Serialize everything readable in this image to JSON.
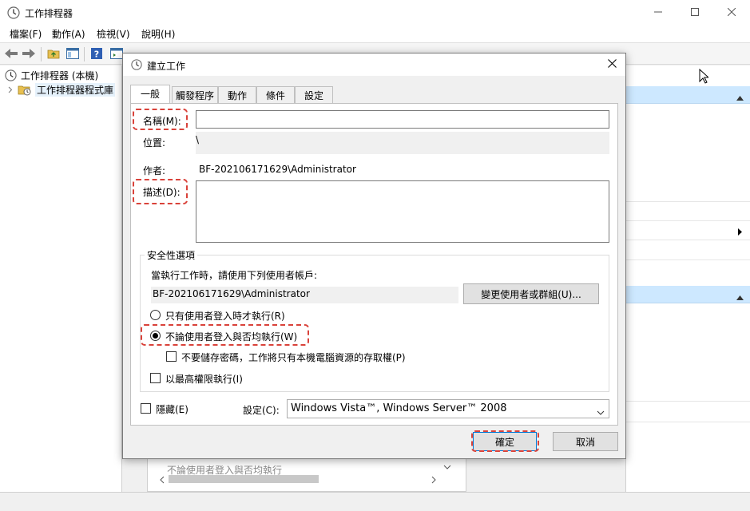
{
  "main_window": {
    "title": "工作排程器",
    "menu": [
      "檔案(F)",
      "動作(A)",
      "檢視(V)",
      "說明(H)"
    ],
    "tree": {
      "root": "工作排程器 (本機)",
      "library": "工作排程器程式庫"
    },
    "background_text": "不論使用者登入與否均執行"
  },
  "dialog": {
    "title": "建立工作",
    "tabs": [
      "一般",
      "觸發程序",
      "動作",
      "條件",
      "設定"
    ],
    "name_label": "名稱(M):",
    "name_value": "",
    "location_label": "位置:",
    "location_value": "\\",
    "author_label": "作者:",
    "author_value": "BF-202106171629\\Administrator",
    "description_label": "描述(D):",
    "description_value": "",
    "security": {
      "legend": "安全性選項",
      "prompt": "當執行工作時，請使用下列使用者帳戶:",
      "account": "BF-202106171629\\Administrator",
      "change_button": "變更使用者或群組(U)...",
      "radio_logged_on": "只有使用者登入時才執行(R)",
      "radio_always": "不論使用者登入與否均執行(W)",
      "selected": "always",
      "no_store_password": "不要儲存密碼，工作將只有本機電腦資源的存取權(P)",
      "no_store_password_checked": false,
      "highest_privileges": "以最高權限執行(I)",
      "highest_privileges_checked": false
    },
    "hidden_label": "隱藏(E)",
    "hidden_checked": false,
    "configure_label": "設定(C):",
    "configure_value": "Windows Vista™, Windows Server™ 2008",
    "ok_button": "確定",
    "cancel_button": "取消"
  },
  "colors": {
    "highlight": "#d9423a",
    "accent": "#0078d7",
    "action_header": "#cde8ff"
  }
}
